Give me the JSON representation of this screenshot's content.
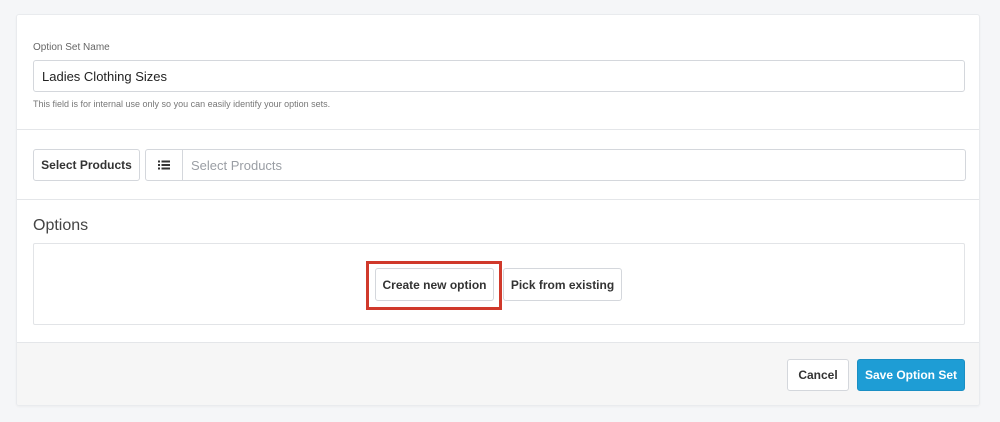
{
  "option_set": {
    "label": "Option Set Name",
    "value": "Ladies Clothing Sizes",
    "help": "This field is for internal use only so you can easily identify your option sets."
  },
  "products": {
    "button_label": "Select Products",
    "placeholder": "Select Products",
    "icon": "list-icon"
  },
  "options": {
    "title": "Options",
    "create_label": "Create new option",
    "pick_label": "Pick from existing"
  },
  "footer": {
    "cancel_label": "Cancel",
    "save_label": "Save Option Set"
  },
  "colors": {
    "primary": "#1e9dd5",
    "highlight": "#d0392b"
  }
}
